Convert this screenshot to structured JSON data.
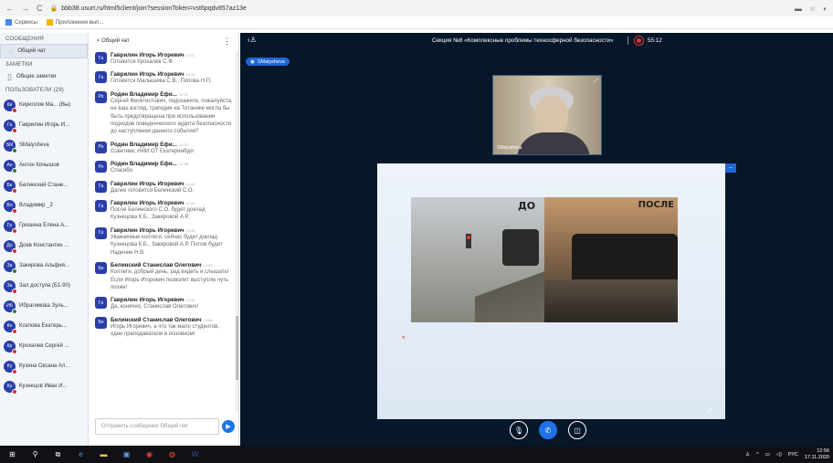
{
  "browser": {
    "url": "bbb38.usurt.ru/html5client/join?sessionToken=vst6pqdv857az13e",
    "bookmarks": [
      "Сервисы",
      "Приложения вып..."
    ]
  },
  "left": {
    "messages_heading": "СООБЩЕНИЯ",
    "public_chat_label": "Общий чат",
    "notes_heading": "ЗАМЕТКИ",
    "shared_notes_label": "Общие заметки",
    "users_heading": "ПОЛЬЗОВАТЕЛИ (29)",
    "users": [
      {
        "initials": "Ки",
        "name": "Кириллов Ма... (Вы)",
        "status": "red"
      },
      {
        "initials": "Га",
        "name": "Гаврилин Игорь И...",
        "status": "red"
      },
      {
        "initials": "SM",
        "name": "SMalysheva",
        "status": "green"
      },
      {
        "initials": "Ан",
        "name": "Антон Кочышов",
        "status": "green"
      },
      {
        "initials": "Бе",
        "name": "Белинский Стани...",
        "status": "red"
      },
      {
        "initials": "Вл",
        "name": "Владимир _2",
        "status": "red"
      },
      {
        "initials": "Гр",
        "name": "Гришина Елена А...",
        "status": "red"
      },
      {
        "initials": "До",
        "name": "Доев Константин ...",
        "status": "red"
      },
      {
        "initials": "За",
        "name": "Закирова Альфия...",
        "status": "green"
      },
      {
        "initials": "За",
        "name": "Зал доступа (Б1-90)",
        "status": "red"
      },
      {
        "initials": "Иб",
        "name": "Ибрагимова Зуль...",
        "status": "green"
      },
      {
        "initials": "Ко",
        "name": "Козлова Екатерь...",
        "status": "red"
      },
      {
        "initials": "Кр",
        "name": "Крохалев Сергей ...",
        "status": "red"
      },
      {
        "initials": "Ку",
        "name": "Кузина Оксана Ал...",
        "status": "red"
      },
      {
        "initials": "Ку",
        "name": "Кузнецов Иван И...",
        "status": "red"
      }
    ]
  },
  "chat": {
    "back_label": "< Общий чат",
    "menu_icon": "⋮",
    "input_placeholder": "Отправить сообщение Общий чат",
    "messages": [
      {
        "initials": "Га",
        "name": "Гаврилин Игорь Игоревич",
        "time": "12:21",
        "text": "Готовится Крохалев С.Ф."
      },
      {
        "initials": "Га",
        "name": "Гаврилин Игорь Игоревич",
        "time": "12:34",
        "text": "Готовятся Малышева С.В., Попова Н.П."
      },
      {
        "initials": "Ро",
        "name": "Родин Владимир Ефи...",
        "time": "12:31",
        "text": "Сергей Феоктистович, подскажите, пожалуйста, на ваш взгляд, трагедия на Титанике могла бы быть предотвращена при использовании подходов поведенческого аудита безопасности до наступления данного события?"
      },
      {
        "initials": "Ро",
        "name": "Родин Владимир Ефи...",
        "time": "12:32",
        "text": "Советник, НИИ ОТ Екатеринбург"
      },
      {
        "initials": "Ро",
        "name": "Родин Владимир Ефи...",
        "time": "12:38",
        "text": "Спасибо"
      },
      {
        "initials": "Га",
        "name": "Гаврилин Игорь Игоревич",
        "time": "12:42",
        "text": "Далее готовится Белинский С.О."
      },
      {
        "initials": "Га",
        "name": "Гаврилин Игорь Игоревич",
        "time": "12:43",
        "text": "После Белинского С.О. будет доклад Кузнецова К.Б., Закировой А.Р."
      },
      {
        "initials": "Га",
        "name": "Гаврилин Игорь Игоревич",
        "time": "12:48",
        "text": "Уважаемые коллеги, сейчас будет доклад Кузнецова К.Б., Закировой А.Р. Потом будет Наденин Н.В."
      },
      {
        "initials": "Бе",
        "name": "Белинский Станислав Олегович",
        "time": "12:53",
        "text": "Коллеги, добрый день, рад видеть и слышать! Если Игорь Игоревич позволит выступлю чуть позже!"
      },
      {
        "initials": "Га",
        "name": "Гаврилин Игорь Игоревич",
        "time": "12:53",
        "text": "Да, конечно, Станислав Олегович!"
      },
      {
        "initials": "Бе",
        "name": "Белинский Станислав Олегович",
        "time": "12:56",
        "text": "Игорь Игоревич, а что так мало студентов, одни преподаватели в основном!"
      }
    ]
  },
  "main": {
    "session_title": "Секция №8 «Комплексные проблемы техносферной безопасности»",
    "timer": "55:12",
    "presenter": "SMalysheva",
    "webcam_label": "SMalysheva",
    "slide_left_caption": "ДО",
    "slide_right_caption": "ПОСЛЕ"
  },
  "taskbar": {
    "lang": "РУС",
    "time": "12:56",
    "date": "17.11.2020"
  },
  "colors": {
    "main_bg": "#06172a",
    "accent": "#1e73e8",
    "avatar": "#2a3ea8",
    "status_red": "#d32f2f",
    "status_green": "#2e7d32"
  }
}
